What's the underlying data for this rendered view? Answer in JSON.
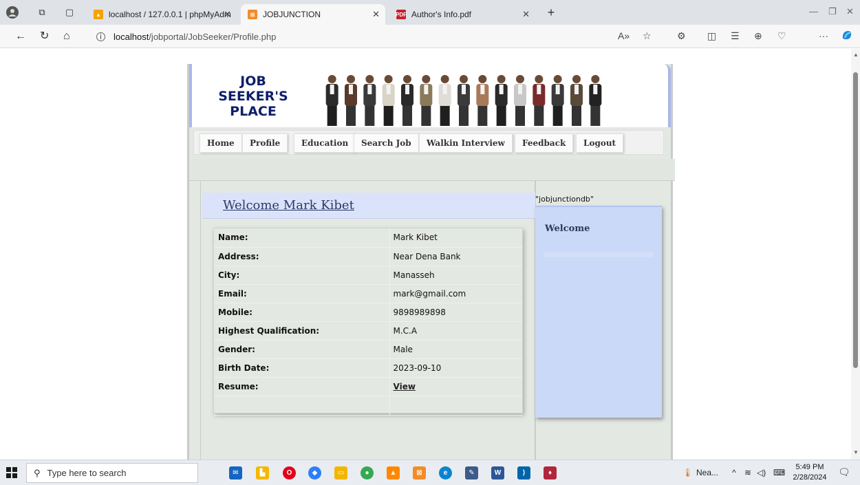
{
  "browser": {
    "tabs": [
      {
        "title": "localhost / 127.0.0.1 | phpMyAdm",
        "active": false
      },
      {
        "title": "JOBJUNCTION",
        "active": true
      },
      {
        "title": "Author's Info.pdf",
        "active": false
      }
    ],
    "url_host": "localhost",
    "url_path": "/jobportal/JobSeeker/Profile.php",
    "new_tab": "+"
  },
  "site": {
    "logo_lines": [
      "JOB",
      "SEEKER'S",
      "PLACE"
    ],
    "menu": [
      "Home",
      "Profile",
      "Education",
      "Search Job",
      "Walkin Interview",
      "Feedback",
      "Logout"
    ],
    "db_label": "\"jobjunctiondb\"",
    "welcome_title": "Welcome Mark Kibet",
    "profile": [
      {
        "label": "Name:",
        "value": "Mark Kibet"
      },
      {
        "label": "Address:",
        "value": "Near Dena Bank"
      },
      {
        "label": "City:",
        "value": "Manasseh"
      },
      {
        "label": "Email:",
        "value": "mark@gmail.com"
      },
      {
        "label": "Mobile:",
        "value": "9898989898"
      },
      {
        "label": "Highest Qualification:",
        "value": "M.C.A"
      },
      {
        "label": "Gender:",
        "value": "Male"
      },
      {
        "label": "Birth Date:",
        "value": "2023-09-10"
      },
      {
        "label": "Resume:",
        "value": "View"
      }
    ],
    "side_title": "Welcome"
  },
  "taskbar": {
    "search_placeholder": "Type here to search",
    "weather": "Nea...",
    "time": "5:49 PM",
    "date": "2/28/2024"
  },
  "colors": {
    "accent_blue": "#0d1f6a",
    "panel_blue": "#cbd9f8",
    "page_grey": "#e3e8e3"
  }
}
